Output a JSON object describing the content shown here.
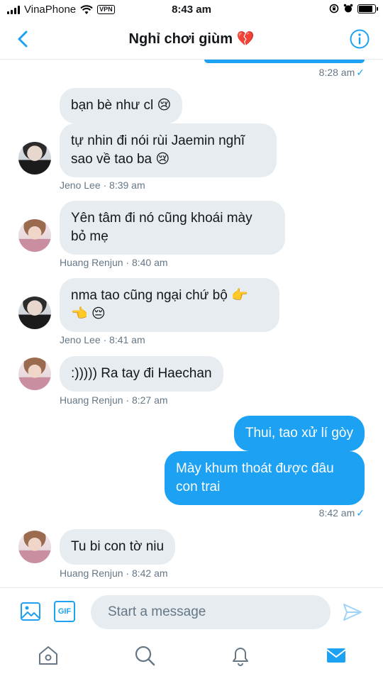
{
  "status_bar": {
    "carrier": "VinaPhone",
    "vpn": "VPN",
    "time": "8:43 am",
    "battery_level": 0.85
  },
  "header": {
    "title": "Nghỉ chơi giùm 💔"
  },
  "messages": {
    "sent_timestamp_1": "8:28 am",
    "sent_check": "✓",
    "group_1": {
      "bubble_1": "bạn bè như cl 😢",
      "bubble_2_line1": "tự nhin đi nói rùi Jaemin nghĩ",
      "bubble_2_line2": "sao về tao ba 😢",
      "meta": "Jeno Lee · 8:39 am"
    },
    "group_2": {
      "line1": "Yên tâm đi nó cũng khoái mày",
      "line2": "bỏ mẹ",
      "meta": "Huang Renjun · 8:40 am"
    },
    "group_3": {
      "line1": "nma tao cũng ngại chứ bộ 👉",
      "line2": "👈 😔",
      "meta": "Jeno Lee · 8:41 am"
    },
    "group_4": {
      "text": ":))))) Ra tay đi Haechan",
      "meta": "Huang Renjun · 8:27 am"
    },
    "sent_1": "Thui, tao xử lí gòy",
    "sent_2_line1": "Mày khum thoát được đâu",
    "sent_2_line2": "con trai",
    "sent_timestamp_2": "8:42 am",
    "group_5": {
      "text": "Tu bi con tờ niu",
      "meta": "Huang Renjun · 8:42 am"
    }
  },
  "composer": {
    "placeholder": "Start a message",
    "gif_label": "GIF"
  },
  "icons": {
    "back": "chevron-left-icon",
    "info": "info-icon",
    "image": "image-icon",
    "gif": "gif-icon",
    "send": "send-icon",
    "home": "home-icon",
    "search": "search-icon",
    "bell": "bell-icon",
    "mail": "mail-icon"
  },
  "colors": {
    "accent": "#1da1f2",
    "bubble_in": "#e6ecf0",
    "meta_text": "#657786"
  }
}
